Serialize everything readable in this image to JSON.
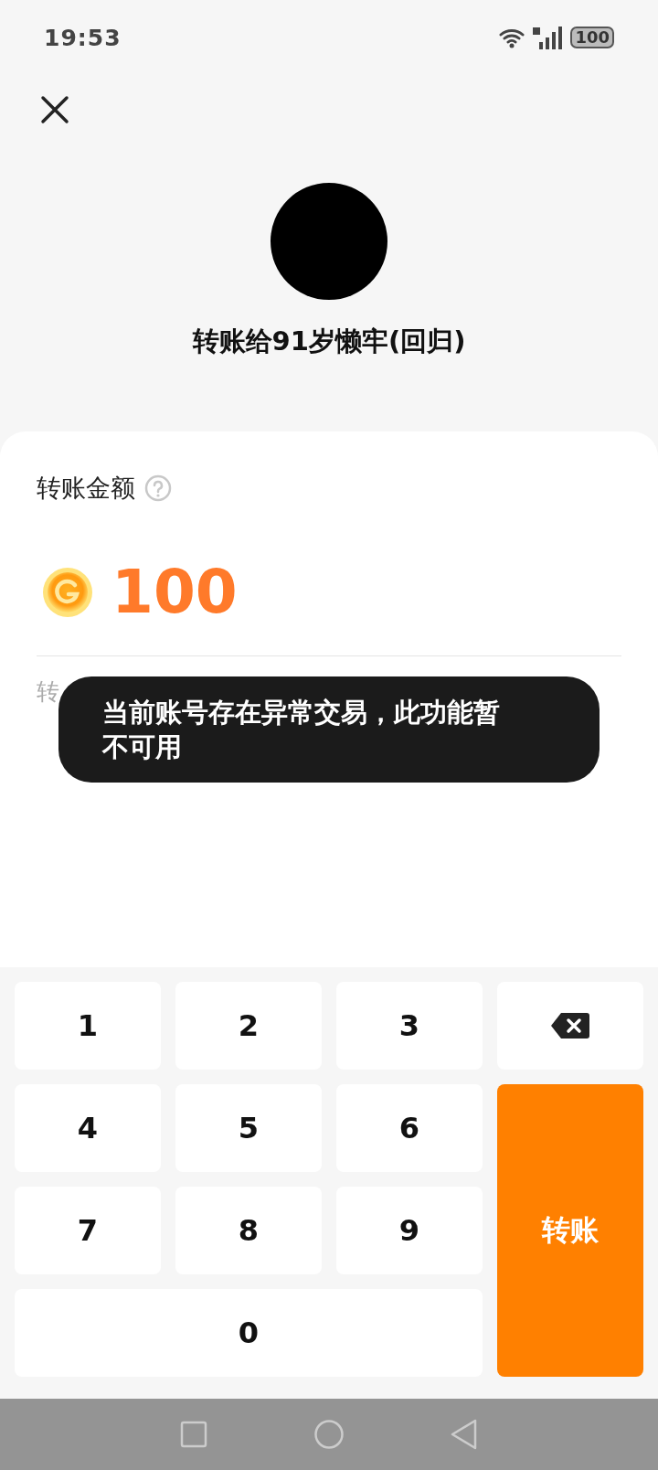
{
  "status_bar": {
    "time": "19:53",
    "battery": "100"
  },
  "recipient": {
    "title": "转账给91岁懒牢(回归)"
  },
  "amount": {
    "label": "转账金额",
    "value": "100"
  },
  "hint_text": "转",
  "toast": {
    "message": "当前账号存在异常交易，此功能暂不可用"
  },
  "keypad": {
    "keys": [
      {
        "kind": "digit",
        "label": "1"
      },
      {
        "kind": "digit",
        "label": "2"
      },
      {
        "kind": "digit",
        "label": "3"
      },
      {
        "kind": "delete"
      },
      {
        "kind": "digit",
        "label": "4"
      },
      {
        "kind": "digit",
        "label": "5"
      },
      {
        "kind": "digit",
        "label": "6"
      },
      {
        "kind": "digit",
        "label": "7"
      },
      {
        "kind": "digit",
        "label": "8"
      },
      {
        "kind": "digit",
        "label": "9"
      },
      {
        "kind": "submit",
        "label": "转账"
      },
      {
        "kind": "wide_digit",
        "label": "0"
      }
    ]
  }
}
